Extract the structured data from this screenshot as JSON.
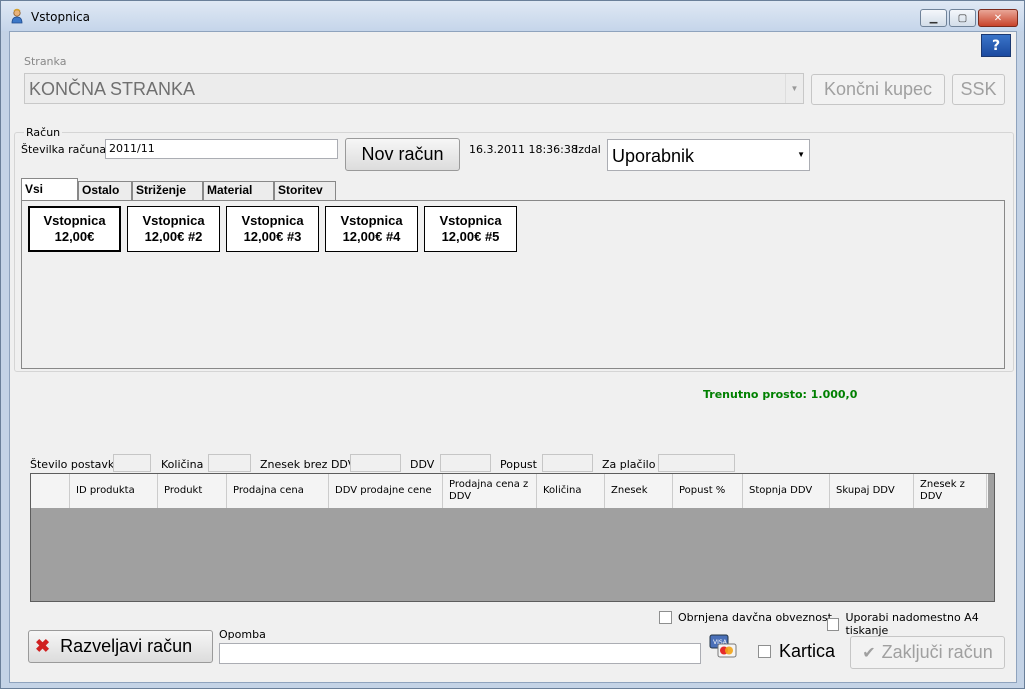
{
  "window": {
    "title": "Vstopnica"
  },
  "stranka": {
    "group_label": "Stranka",
    "value": "KONČNA STRANKA",
    "koncni_kupec_label": "Končni kupec",
    "ssk_label": "SSK"
  },
  "racun": {
    "group_label": "Račun",
    "stevilka_label": "Številka računa",
    "stevilka_value": "2011/11",
    "nov_racun_label": "Nov račun",
    "datetime": "16.3.2011 18:36:38",
    "izdal_label": "Izdal",
    "izdal_value": "Uporabnik"
  },
  "tabs": [
    {
      "label": "Vsi",
      "active": true
    },
    {
      "label": "Ostalo",
      "active": false
    },
    {
      "label": "Striženje",
      "active": false
    },
    {
      "label": "Material",
      "active": false
    },
    {
      "label": "Storitev",
      "active": false
    }
  ],
  "products": [
    {
      "line1": "Vstopnica",
      "line2": "12,00€"
    },
    {
      "line1": "Vstopnica",
      "line2": "12,00€ #2"
    },
    {
      "line1": "Vstopnica",
      "line2": "12,00€ #3"
    },
    {
      "line1": "Vstopnica",
      "line2": "12,00€ #4"
    },
    {
      "line1": "Vstopnica",
      "line2": "12,00€ #5"
    }
  ],
  "status": {
    "trenutno_prosto": "Trenutno prosto: 1.000,0"
  },
  "totals": {
    "stevilo_postavk": "Število postavk",
    "kolicina": "Količina",
    "znesek_brez_ddv": "Znesek brez DDV",
    "ddv": "DDV",
    "popust": "Popust",
    "za_placilo": "Za plačilo"
  },
  "grid": {
    "columns": [
      "ID produkta",
      "Produkt",
      "Prodajna cena",
      "DDV prodajne cene",
      "Prodajna cena z DDV",
      "Količina",
      "Znesek",
      "Popust %",
      "Stopnja DDV",
      "Skupaj DDV",
      "Znesek z DDV"
    ]
  },
  "options": {
    "obrnjena_label": "Obrnjena davčna obveznost",
    "a4_label": "Uporabi nadomestno A4 tiskanje"
  },
  "bottom": {
    "razveljavi_label": "Razveljavi račun",
    "opomba_label": "Opomba",
    "kartica_label": "Kartica",
    "zakljuci_label": "Zaključi račun"
  }
}
